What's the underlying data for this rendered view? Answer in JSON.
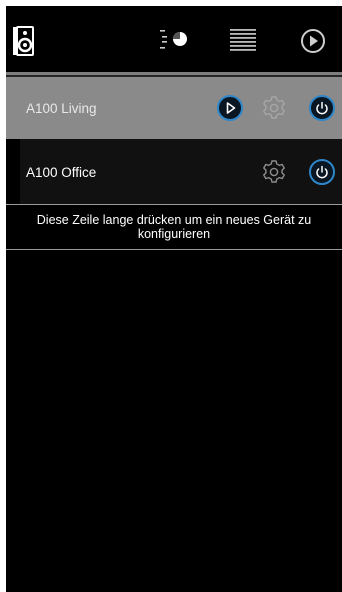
{
  "topbar": {
    "icons": [
      "speaker-icon",
      "volume-knob-icon",
      "playlist-icon",
      "play-circle-icon"
    ]
  },
  "devices": [
    {
      "name": "A100 Living",
      "selected": true,
      "has_play": true
    },
    {
      "name": "A100 Office",
      "selected": false,
      "has_play": false
    }
  ],
  "hint": {
    "text": "Diese Zeile lange drücken um ein neues Gerät zu konfigurieren"
  },
  "colors": {
    "accent": "#2f86c8",
    "selected_row": "#8a8a8a",
    "row": "#111111",
    "background": "#000000"
  }
}
